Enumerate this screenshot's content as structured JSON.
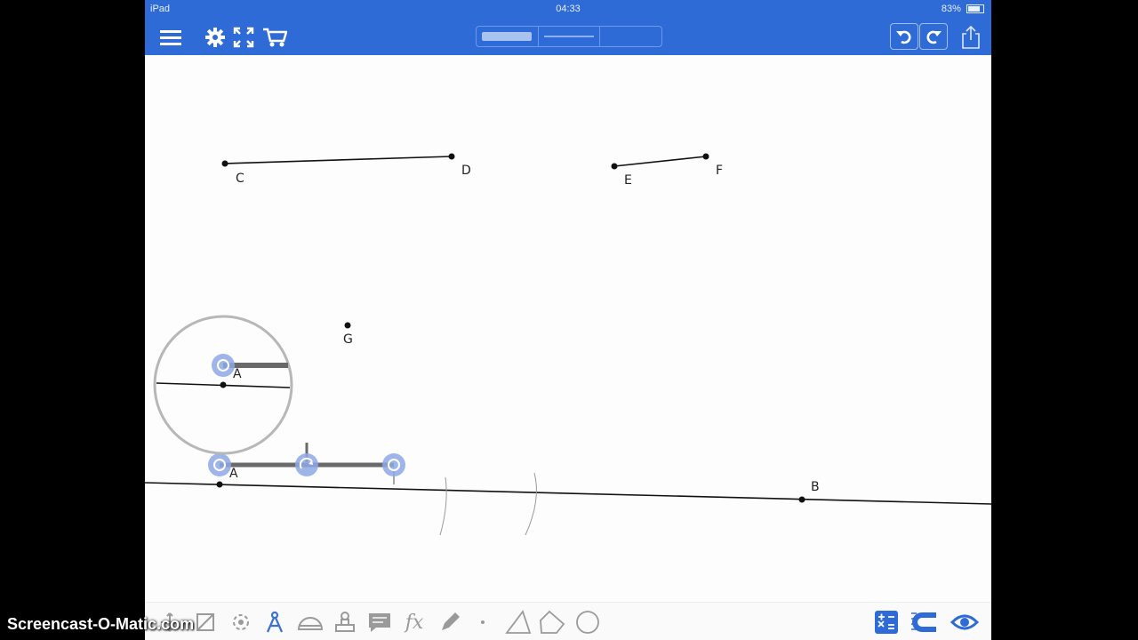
{
  "status_bar": {
    "device": "iPad",
    "time": "04:33",
    "battery": "83%"
  },
  "nav": {
    "left_icons": [
      "menu-icon",
      "gear-icon",
      "fullscreen-icon",
      "cart-icon"
    ],
    "right_icons": [
      "undo-icon",
      "redo-icon",
      "share-icon"
    ],
    "accent_color": "#2f6bd6"
  },
  "canvas": {
    "point_labels": {
      "A": "A",
      "B": "B",
      "C": "C",
      "D": "D",
      "E": "E",
      "F": "F",
      "G": "G"
    },
    "magnifier_label": "A"
  },
  "toolbar": {
    "tools": [
      "move-tool-icon",
      "transform-tool-icon",
      "rotate-tool-icon",
      "compass-icon",
      "protractor-icon",
      "ruler-stamp-icon",
      "text-icon",
      "function-icon",
      "pencil-icon",
      "point-icon",
      "triangle-icon",
      "polygon-icon",
      "circle-icon"
    ],
    "function_label": "fx",
    "right_tools": [
      "calculator-icon",
      "magnet-icon",
      "eye-icon"
    ]
  },
  "watermark": "Screencast-O-Matic.com"
}
